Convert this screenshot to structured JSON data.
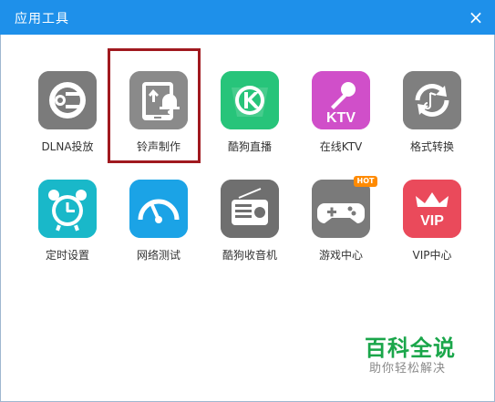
{
  "dialog": {
    "title": "应用工具",
    "close_glyph": "×"
  },
  "tools": [
    {
      "label": "DLNA投放",
      "icon": "dlna-icon",
      "color": "#7b7b7b"
    },
    {
      "label": "铃声制作",
      "icon": "ringtone-icon",
      "color": "#8a8a8a",
      "selected": true
    },
    {
      "label": "酷狗直播",
      "icon": "kugou-live-icon",
      "color": "#27c47a"
    },
    {
      "label": "在线KTV",
      "icon": "ktv-icon",
      "color": "#d04fc9"
    },
    {
      "label": "格式转换",
      "icon": "format-convert-icon",
      "color": "#7f7f7f"
    },
    {
      "label": "定时设置",
      "icon": "alarm-clock-icon",
      "color": "#19b8c9"
    },
    {
      "label": "网络测试",
      "icon": "speedometer-icon",
      "color": "#1ba3e6"
    },
    {
      "label": "酷狗收音机",
      "icon": "radio-icon",
      "color": "#6f6f6f"
    },
    {
      "label": "游戏中心",
      "icon": "gamepad-icon",
      "color": "#7a7a7a",
      "badge": "HOT"
    },
    {
      "label": "VIP中心",
      "icon": "vip-crown-icon",
      "color": "#ea4a5b"
    }
  ],
  "watermark": {
    "main": "百科全说",
    "sub": "助你轻松解决"
  }
}
